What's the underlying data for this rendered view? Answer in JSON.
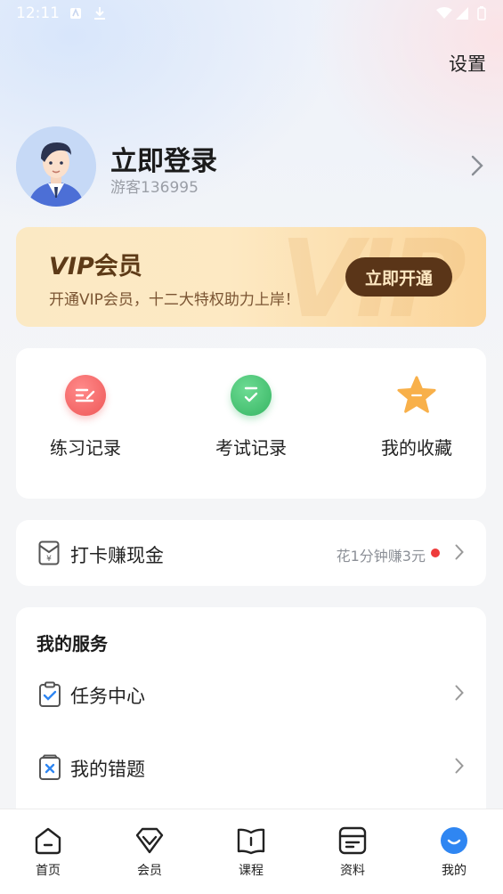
{
  "status_bar": {
    "time": "12:11"
  },
  "header": {
    "settings_label": "设置"
  },
  "profile": {
    "title": "立即登录",
    "guest_id": "游客136995"
  },
  "vip": {
    "title_en": "VIP",
    "title_cn": "会员",
    "subtitle": "开通VIP会员，十二大特权助力上岸！",
    "button_label": "立即开通",
    "deco_text": "VIP"
  },
  "quick_actions": [
    {
      "label": "练习记录",
      "icon": "practice-record-icon",
      "color": "#f66b6b"
    },
    {
      "label": "考试记录",
      "icon": "exam-record-icon",
      "color": "#42c16f"
    },
    {
      "label": "我的收藏",
      "icon": "star-icon",
      "color": "#f8b04a"
    }
  ],
  "checkin": {
    "label": "打卡赚现金",
    "hint": "花1分钟赚3元"
  },
  "services": {
    "title": "我的服务",
    "items": [
      {
        "label": "任务中心",
        "icon": "task-clipboard-icon"
      },
      {
        "label": "我的错题",
        "icon": "wrong-question-icon"
      }
    ]
  },
  "bottom_nav": [
    {
      "label": "首页",
      "icon": "home-icon"
    },
    {
      "label": "会员",
      "icon": "vip-diamond-icon"
    },
    {
      "label": "课程",
      "icon": "course-book-icon"
    },
    {
      "label": "资料",
      "icon": "materials-icon"
    },
    {
      "label": "我的",
      "icon": "profile-icon",
      "active": true
    }
  ],
  "colors": {
    "accent_blue": "#2f86f2",
    "vip_brown": "#5a3518",
    "red_dot": "#ee3b3b"
  }
}
